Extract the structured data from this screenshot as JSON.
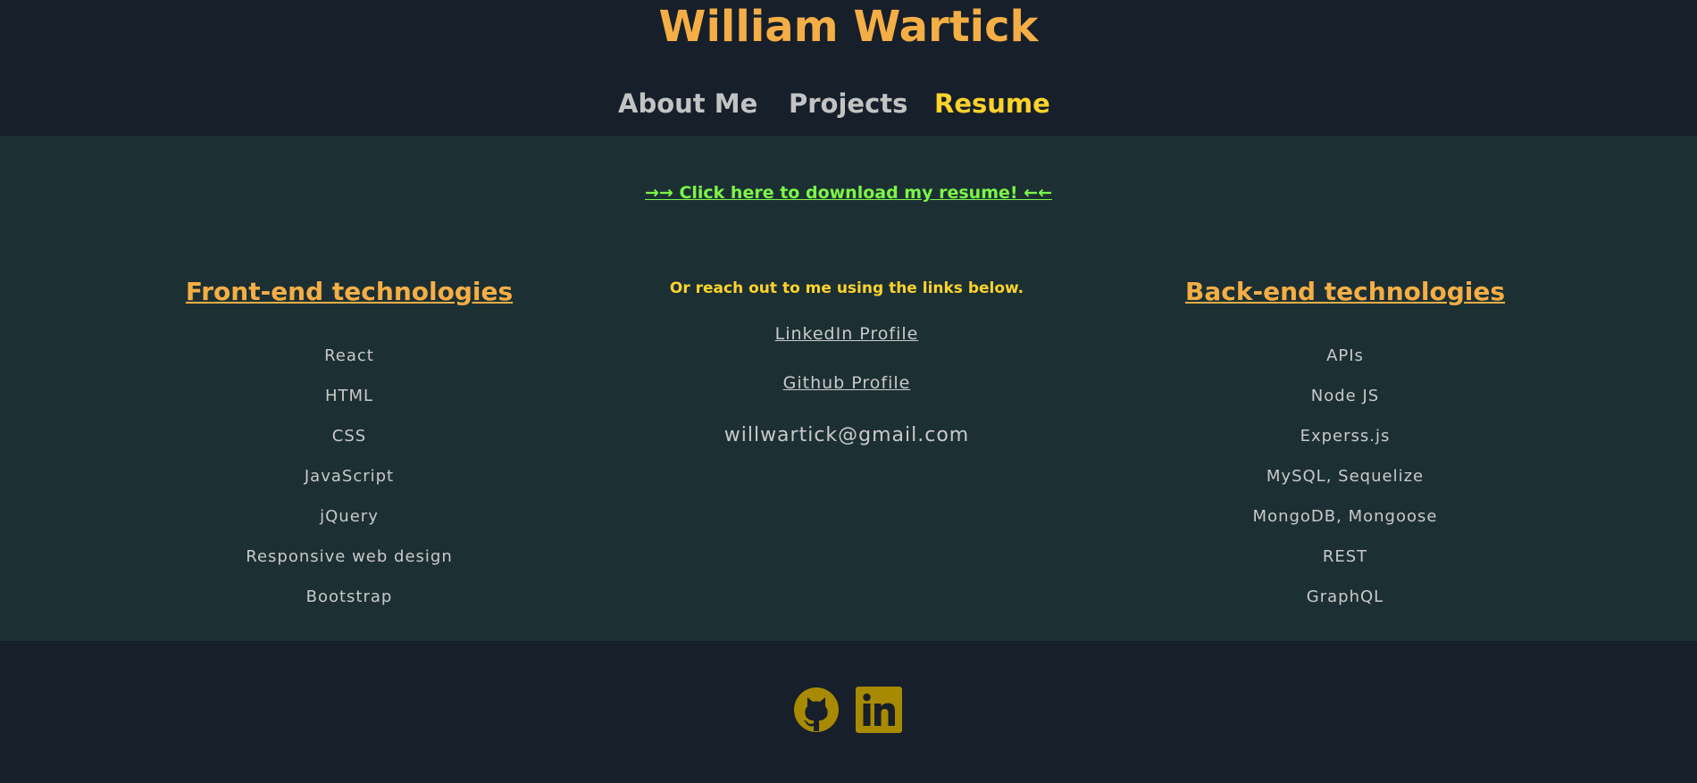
{
  "header": {
    "title": "William Wartick",
    "nav": [
      {
        "label": "About Me",
        "active": false
      },
      {
        "label": "Projects",
        "active": false
      },
      {
        "label": "Resume",
        "active": true
      }
    ]
  },
  "main": {
    "download_link": "→→ Click here to download my resume! ←←",
    "frontend": {
      "heading": "Front-end technologies",
      "items": [
        "React",
        "HTML",
        "CSS",
        "JavaScript",
        "jQuery",
        "Responsive web design",
        "Bootstrap"
      ]
    },
    "contact": {
      "intro": "Or reach out to me using the links below.",
      "linkedin_label": "LinkedIn Profile",
      "github_label": "Github Profile",
      "email": "willwartick@gmail.com"
    },
    "backend": {
      "heading": "Back-end technologies",
      "items": [
        "APIs",
        "Node JS",
        "Experss.js",
        "MySQL, Sequelize",
        "MongoDB, Mongoose",
        "REST",
        "GraphQL"
      ]
    }
  },
  "footer": {
    "icons": [
      {
        "name": "github-icon"
      },
      {
        "name": "linkedin-icon"
      }
    ]
  },
  "colors": {
    "header_bg": "#161f2a",
    "main_bg": "#1c3034",
    "title": "#f5ae45",
    "nav": "#c3c3c3",
    "nav_active": "#ffd32a",
    "download_link": "#7cf547",
    "body_text": "#c9c9c9",
    "icon": "#a88a00"
  }
}
